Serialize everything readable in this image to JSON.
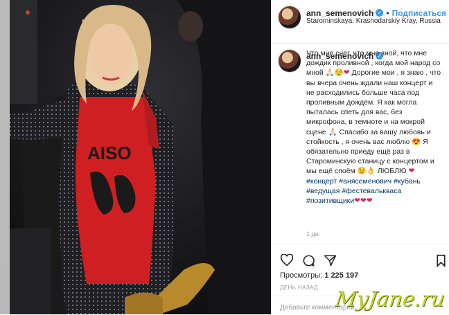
{
  "post": {
    "username": "ann_semenovich",
    "follow_label": "Подписаться",
    "location": "Starominskaya, Krasnodarskiy Kray, Russia",
    "caption_parts": [
      {
        "t": "Что мне снег, что мне зной, что мне дождик проливной , когда мой народ со мной "
      },
      {
        "t": "🙏🏻😌",
        "k": "emoji"
      },
      {
        "t": "❤",
        "k": "heart"
      },
      {
        "t": " Дорогие мои , я знаю , что вы вчера очень ждали наш концерт и не расходились больше часа под проливным дождём. Я как могла пыталась спеть для вас, без микрофона, в темноте и на мокрой сцене "
      },
      {
        "t": "🙏🏻",
        "k": "emoji"
      },
      {
        "t": " Спасибо за вашу любовь и стойкость , я очень вас люблю "
      },
      {
        "t": "😍",
        "k": "emoji"
      },
      {
        "t": " Я обязательно приеду ещё раз в Староминскую станицу с концертом и мы ещё споём "
      },
      {
        "t": "😉👌",
        "k": "emoji"
      },
      {
        "t": " ЛЮБЛЮ "
      },
      {
        "t": "❤",
        "k": "heart"
      },
      {
        "t": " "
      },
      {
        "t": "#концерт",
        "k": "tag"
      },
      {
        "t": " "
      },
      {
        "t": "#анясеменович",
        "k": "tag"
      },
      {
        "t": " "
      },
      {
        "t": "#кубань",
        "k": "tag"
      },
      {
        "t": " "
      },
      {
        "t": "#ведущая",
        "k": "tag"
      },
      {
        "t": " "
      },
      {
        "t": "#фестевалькваса",
        "k": "tag"
      },
      {
        "t": " "
      },
      {
        "t": "#позитивщики",
        "k": "tag"
      },
      {
        "t": "❤❤❤",
        "k": "heart"
      }
    ],
    "time": "1 дн.",
    "views_label": "Просмотры:",
    "views_count": "1 225 197",
    "date_ago": "ДЕНЬ НАЗАД",
    "comment_placeholder": "Добавьте комментарий...",
    "video_shirt_text": "AISO",
    "watermark": "MyJane.ru"
  }
}
